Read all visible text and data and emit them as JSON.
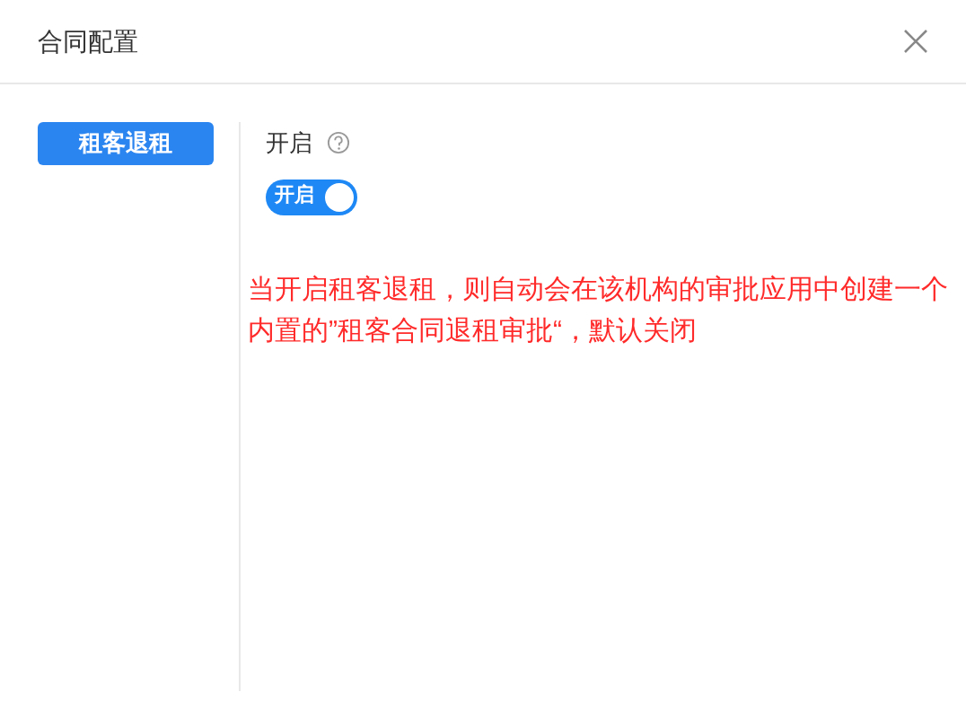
{
  "dialog": {
    "title": "合同配置"
  },
  "sidebar": {
    "items": [
      {
        "label": "租客退租",
        "selected": true
      }
    ]
  },
  "setting": {
    "label": "开启",
    "toggle": {
      "on": true,
      "label": "开启"
    }
  },
  "note": "当开启租客退租，则自动会在该机构的审批应用中创建一个内置的”租客合同退租审批“，默认关闭"
}
